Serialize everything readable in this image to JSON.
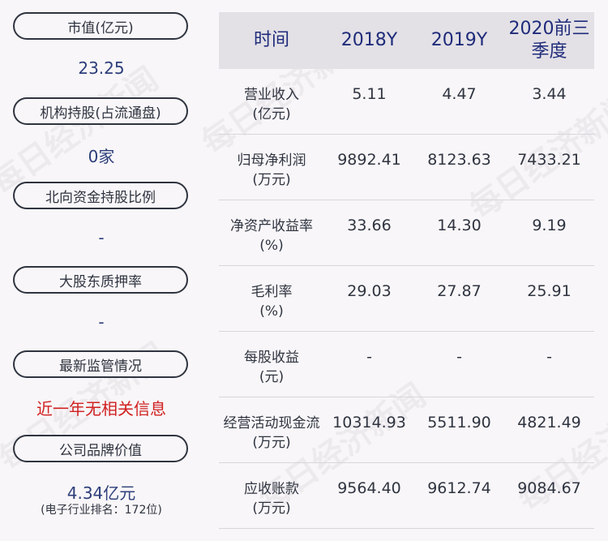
{
  "watermark": "每日经济新闻",
  "left": [
    {
      "label": "市值(亿元)",
      "value": "23.25"
    },
    {
      "label": "机构持股(占流通盘)",
      "value": "0家"
    },
    {
      "label": "北向资金持股比例",
      "value": "-"
    },
    {
      "label": "大股东质押率",
      "value": "-"
    },
    {
      "label": "最新监管情况",
      "value": "近一年无相关信息"
    },
    {
      "label": "公司品牌价值",
      "value": "4.34亿元",
      "note": "(电子行业排名：172位)"
    }
  ],
  "table": {
    "headers": [
      "时间",
      "2018Y",
      "2019Y",
      "2020前三季度"
    ],
    "rows": [
      {
        "label": "营业收入\n(亿元)",
        "values": [
          "5.11",
          "4.47",
          "3.44"
        ]
      },
      {
        "label": "归母净利润\n(万元)",
        "values": [
          "9892.41",
          "8123.63",
          "7433.21"
        ]
      },
      {
        "label": "净资产收益率\n(%)",
        "values": [
          "33.66",
          "14.30",
          "9.19"
        ]
      },
      {
        "label": "毛利率\n(%)",
        "values": [
          "29.03",
          "27.87",
          "25.91"
        ]
      },
      {
        "label": "每股收益\n(元)",
        "values": [
          "-",
          "-",
          "-"
        ]
      },
      {
        "label": "经营活动现金流\n(万元)",
        "values": [
          "10314.93",
          "5511.90",
          "4821.49"
        ]
      },
      {
        "label": "应收账款\n(万元)",
        "values": [
          "9564.40",
          "9612.74",
          "9084.67"
        ]
      }
    ]
  }
}
